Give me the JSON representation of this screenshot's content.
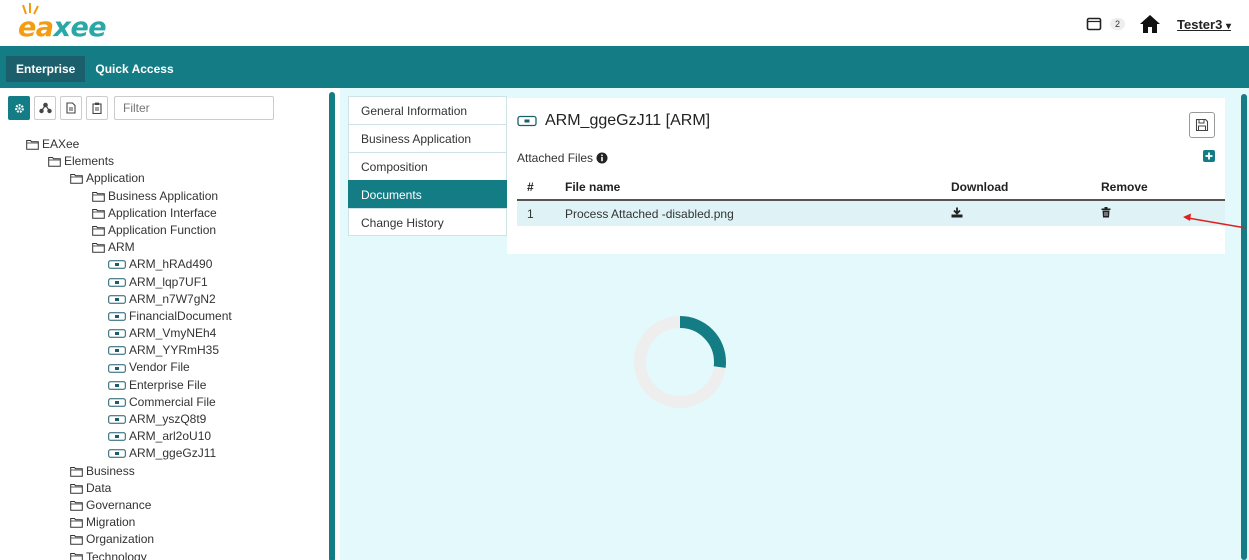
{
  "header": {
    "logo": {
      "part1": "ea",
      "part2": "xee"
    },
    "notification_count": "2",
    "user": "Tester3",
    "user_caret": "▾"
  },
  "navbar": {
    "tabs": [
      {
        "label": "Enterprise",
        "active": true
      },
      {
        "label": "Quick Access",
        "active": false
      }
    ]
  },
  "left_panel": {
    "filter_placeholder": "Filter",
    "tree": [
      {
        "label": "EAXee",
        "depth": 0,
        "type": "folder"
      },
      {
        "label": "Elements",
        "depth": 1,
        "type": "folder"
      },
      {
        "label": "Application",
        "depth": 2,
        "type": "folder"
      },
      {
        "label": "Business Application",
        "depth": 3,
        "type": "folder"
      },
      {
        "label": "Application Interface",
        "depth": 3,
        "type": "folder"
      },
      {
        "label": "Application Function",
        "depth": 3,
        "type": "folder"
      },
      {
        "label": "ARM",
        "depth": 3,
        "type": "folder"
      },
      {
        "label": "ARM_hRAd490",
        "depth": 4,
        "type": "element"
      },
      {
        "label": "ARM_lqp7UF1",
        "depth": 4,
        "type": "element"
      },
      {
        "label": "ARM_n7W7gN2",
        "depth": 4,
        "type": "element"
      },
      {
        "label": "FinancialDocument",
        "depth": 4,
        "type": "element"
      },
      {
        "label": "ARM_VmyNEh4",
        "depth": 4,
        "type": "element"
      },
      {
        "label": "ARM_YYRmH35",
        "depth": 4,
        "type": "element"
      },
      {
        "label": "Vendor File",
        "depth": 4,
        "type": "element"
      },
      {
        "label": "Enterprise File",
        "depth": 4,
        "type": "element"
      },
      {
        "label": "Commercial File",
        "depth": 4,
        "type": "element"
      },
      {
        "label": "ARM_yszQ8t9",
        "depth": 4,
        "type": "element"
      },
      {
        "label": "ARM_arl2oU10",
        "depth": 4,
        "type": "element"
      },
      {
        "label": "ARM_ggeGzJ11",
        "depth": 4,
        "type": "element"
      },
      {
        "label": "Business",
        "depth": 2,
        "type": "folder"
      },
      {
        "label": "Data",
        "depth": 2,
        "type": "folder"
      },
      {
        "label": "Governance",
        "depth": 2,
        "type": "folder"
      },
      {
        "label": "Migration",
        "depth": 2,
        "type": "folder"
      },
      {
        "label": "Organization",
        "depth": 2,
        "type": "folder"
      },
      {
        "label": "Technology",
        "depth": 2,
        "type": "folder"
      }
    ]
  },
  "side_tabs": [
    {
      "label": "General Information",
      "active": false
    },
    {
      "label": "Business Application",
      "active": false
    },
    {
      "label": "Composition",
      "active": false
    },
    {
      "label": "Documents",
      "active": true
    },
    {
      "label": "Change History",
      "active": false
    }
  ],
  "document": {
    "title": "ARM_ggeGzJ11 [ARM]",
    "attached_label": "Attached Files",
    "columns": [
      "#",
      "File name",
      "Download",
      "Remove"
    ],
    "rows": [
      {
        "num": "1",
        "file": "Process Attached -disabled.png"
      }
    ]
  },
  "loading": {
    "progress": 0.27
  },
  "colors": {
    "teal": "#147c85",
    "teal_dark": "#1a5f6b",
    "panel_bg": "#e3f9fc",
    "logo_orange": "#f39c12",
    "logo_teal": "#2aa8a8",
    "annotation_red": "#e02020"
  }
}
